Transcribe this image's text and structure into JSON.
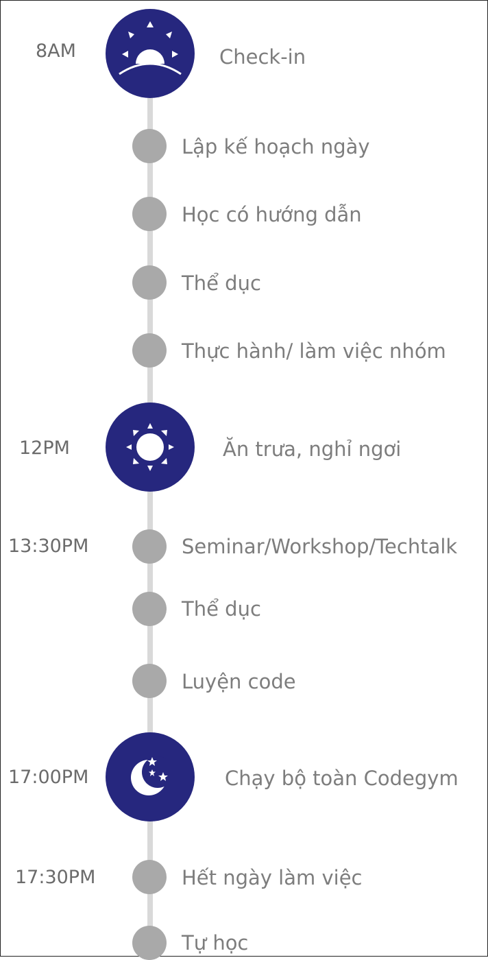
{
  "colors": {
    "accent": "#26277e",
    "dot": "#a9a9a9",
    "line": "#d9d9d9",
    "text": "#7d7d7d"
  },
  "timeline": [
    {
      "time": "8AM",
      "label": "Check-in",
      "icon": "sunrise-icon"
    },
    {
      "time": "",
      "label": "Lập kế hoạch ngày"
    },
    {
      "time": "",
      "label": "Học có hướng dẫn"
    },
    {
      "time": "",
      "label": "Thể dục"
    },
    {
      "time": "",
      "label": "Thực hành/ làm việc nhóm"
    },
    {
      "time": "12PM",
      "label": "Ăn trưa, nghỉ ngơi",
      "icon": "sun-icon"
    },
    {
      "time": "13:30PM",
      "label": "Seminar/Workshop/Techtalk"
    },
    {
      "time": "",
      "label": "Thể dục"
    },
    {
      "time": "",
      "label": "Luyện code"
    },
    {
      "time": "17:00PM",
      "label": "Chạy bộ toàn Codegym",
      "icon": "moon-icon"
    },
    {
      "time": "17:30PM",
      "label": "Hết ngày làm việc"
    },
    {
      "time": "",
      "label": "Tự học"
    }
  ]
}
